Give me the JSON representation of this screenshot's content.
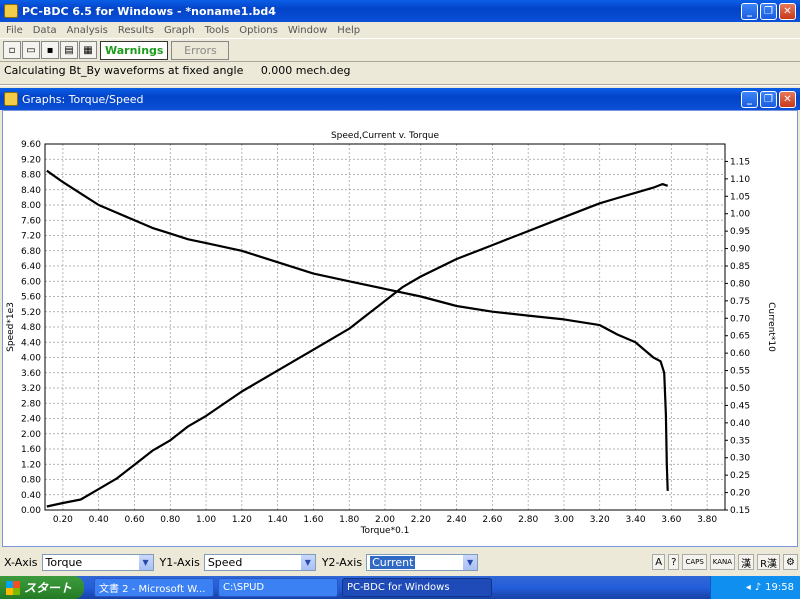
{
  "app_window": {
    "title": "PC-BDC 6.5 for Windows - *noname1.bd4",
    "menu": [
      "File",
      "Data",
      "Analysis",
      "Results",
      "Graph",
      "Tools",
      "Options",
      "Window",
      "Help"
    ],
    "toolbar": {
      "warnings_label": "Warnings",
      "errors_label": "Errors"
    },
    "status_text": "Calculating Bt_By waveforms at fixed angle     0.000 mech.deg"
  },
  "graph_window": {
    "title": "Graphs: Torque/Speed"
  },
  "chart_data": {
    "type": "line",
    "title": "Speed,Current v. Torque",
    "xlabel": "Torque*0.1",
    "ylabel": "Speed*1e3",
    "y2label": "Current*10",
    "xlim": [
      0.1,
      3.9
    ],
    "ylim": [
      0,
      9.6
    ],
    "y2lim": [
      0.15,
      1.2
    ],
    "grid": true,
    "x_ticks": [
      "0.20",
      "0.40",
      "0.60",
      "0.80",
      "1.00",
      "1.20",
      "1.40",
      "1.60",
      "1.80",
      "2.00",
      "2.20",
      "2.40",
      "2.60",
      "2.80",
      "3.00",
      "3.20",
      "3.40",
      "3.60",
      "3.80"
    ],
    "y_ticks": [
      "0.00",
      "0.40",
      "0.80",
      "1.20",
      "1.60",
      "2.00",
      "2.40",
      "2.80",
      "3.20",
      "3.60",
      "4.00",
      "4.40",
      "4.80",
      "5.20",
      "5.60",
      "6.00",
      "6.40",
      "6.80",
      "7.20",
      "7.60",
      "8.00",
      "8.40",
      "8.80",
      "9.20",
      "9.60"
    ],
    "y2_ticks": [
      "0.15",
      "0.20",
      "0.25",
      "0.30",
      "0.35",
      "0.40",
      "0.45",
      "0.50",
      "0.55",
      "0.60",
      "0.65",
      "0.70",
      "0.75",
      "0.80",
      "0.85",
      "0.90",
      "0.95",
      "1.00",
      "1.05",
      "1.10",
      "1.15"
    ],
    "series": [
      {
        "axis": "y1",
        "x": [
          0.11,
          0.2,
          0.3,
          0.4,
          0.5,
          0.6,
          0.7,
          0.8,
          0.9,
          1.0,
          1.2,
          1.4,
          1.6,
          1.8,
          2.0,
          2.2,
          2.4,
          2.6,
          2.8,
          3.0,
          3.2,
          3.3,
          3.4,
          3.5,
          3.54,
          3.56,
          3.57,
          3.575,
          3.58
        ],
        "y": [
          8.9,
          8.6,
          8.3,
          8.0,
          7.8,
          7.6,
          7.4,
          7.25,
          7.1,
          7.0,
          6.8,
          6.5,
          6.2,
          6.0,
          5.8,
          5.6,
          5.35,
          5.2,
          5.1,
          5.0,
          4.85,
          4.6,
          4.4,
          4.0,
          3.9,
          3.6,
          2.5,
          1.2,
          0.5
        ]
      },
      {
        "axis": "y2",
        "x": [
          0.11,
          0.2,
          0.3,
          0.4,
          0.5,
          0.6,
          0.7,
          0.8,
          0.9,
          1.0,
          1.2,
          1.4,
          1.6,
          1.8,
          1.9,
          2.0,
          2.1,
          2.2,
          2.4,
          2.6,
          2.8,
          3.0,
          3.2,
          3.3,
          3.4,
          3.5,
          3.55,
          3.58
        ],
        "y": [
          0.16,
          0.17,
          0.18,
          0.21,
          0.24,
          0.28,
          0.32,
          0.35,
          0.39,
          0.42,
          0.49,
          0.55,
          0.61,
          0.67,
          0.71,
          0.75,
          0.79,
          0.82,
          0.87,
          0.91,
          0.95,
          0.99,
          1.03,
          1.045,
          1.06,
          1.075,
          1.085,
          1.08
        ]
      }
    ]
  },
  "axes_bar": {
    "x_label": "X-Axis",
    "x_value": "Torque",
    "y1_label": "Y1-Axis",
    "y1_value": "Speed",
    "y2_label": "Y2-Axis",
    "y2_value": "Current"
  },
  "ime": {
    "caps": "CAPS",
    "kana": "KANA",
    "han": "漢",
    "mode": "R漢"
  },
  "taskbar": {
    "start": "スタート",
    "tasks": [
      "文書 2 - Microsoft W...",
      "C:\\SPUD",
      "PC-BDC for Windows"
    ],
    "clock": "19:58"
  }
}
